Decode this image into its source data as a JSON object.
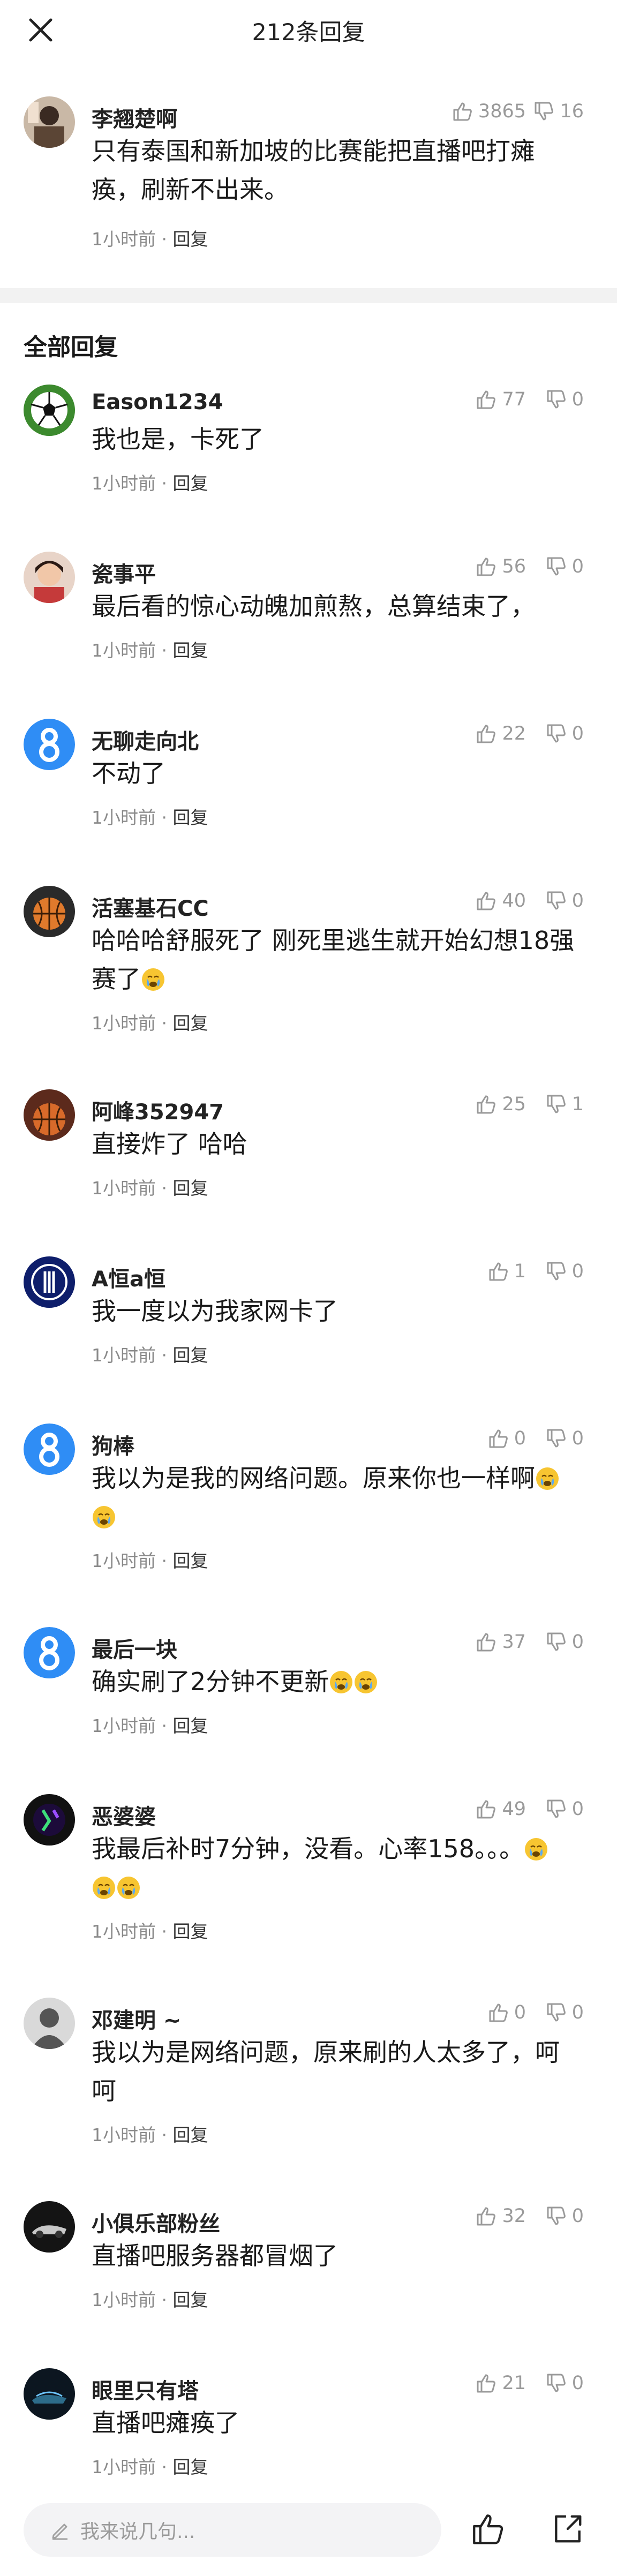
{
  "header": {
    "title": "212条回复",
    "close_icon": "close-icon"
  },
  "top_comment": {
    "user": "李翘楚啊",
    "likes": "3865",
    "dislikes": "16",
    "line1": "只有泰国和新加坡的比赛能把直播吧打瘫",
    "line2": "痪，刷新不出来。",
    "time": "1小时前",
    "reply": "回复"
  },
  "section_title": "全部回复",
  "replies": [
    {
      "user": "Eason1234",
      "likes": "77",
      "dislikes": "0",
      "line1": "我也是，卡死了",
      "line2": "",
      "time": "1小时前",
      "reply": "回复"
    },
    {
      "user": "瓷事平",
      "likes": "56",
      "dislikes": "0",
      "line1": "最后看的惊心动魄加煎熬，总算结束了，",
      "line2": "",
      "time": "1小时前",
      "reply": "回复"
    },
    {
      "user": "无聊走向北",
      "likes": "22",
      "dislikes": "0",
      "line1": "不动了",
      "line2": "",
      "time": "1小时前",
      "reply": "回复"
    },
    {
      "user": "活塞基石CC",
      "likes": "40",
      "dislikes": "0",
      "line1": "哈哈哈舒服死了 刚死里逃生就开始幻想18强",
      "line2": "赛了",
      "time": "1小时前",
      "reply": "回复"
    },
    {
      "user": "阿峰352947",
      "likes": "25",
      "dislikes": "1",
      "line1": "直接炸了 哈哈",
      "line2": "",
      "time": "1小时前",
      "reply": "回复"
    },
    {
      "user": "A恒a恒",
      "likes": "1",
      "dislikes": "0",
      "line1": "我一度以为我家网卡了",
      "line2": "",
      "time": "1小时前",
      "reply": "回复"
    },
    {
      "user": "狗棒",
      "likes": "0",
      "dislikes": "0",
      "line1": "我以为是我的网络问题。原来你也一样啊",
      "line2": "",
      "time": "1小时前",
      "reply": "回复"
    },
    {
      "user": "最后一块",
      "likes": "37",
      "dislikes": "0",
      "line1": "确实刷了2分钟不更新",
      "line2": "",
      "time": "1小时前",
      "reply": "回复"
    },
    {
      "user": "恶婆婆",
      "likes": "49",
      "dislikes": "0",
      "line1": "我最后补时7分钟，没看。心率158。。。",
      "line2": "",
      "time": "1小时前",
      "reply": "回复"
    },
    {
      "user": "邓建明 ~",
      "likes": "0",
      "dislikes": "0",
      "line1": "我以为是网络问题，原来刷的人太多了，呵",
      "line2": "呵",
      "time": "1小时前",
      "reply": "回复"
    },
    {
      "user": "小俱乐部粉丝",
      "likes": "32",
      "dislikes": "0",
      "line1": "直播吧服务器都冒烟了",
      "line2": "",
      "time": "1小时前",
      "reply": "回复"
    },
    {
      "user": "眼里只有塔",
      "likes": "21",
      "dislikes": "0",
      "line1": "直播吧瘫痪了",
      "line2": "",
      "time": "1小时前",
      "reply": "回复"
    }
  ],
  "bottom_bar": {
    "placeholder": "我来说几句...",
    "like_icon": "thumb-up-icon",
    "share_icon": "share-icon"
  },
  "colors": {
    "meta_gray": "#8a8a8a",
    "divider": "#f2f2f2",
    "brand_blue": "#2f8df5",
    "input_bg": "#f3f3f5"
  }
}
